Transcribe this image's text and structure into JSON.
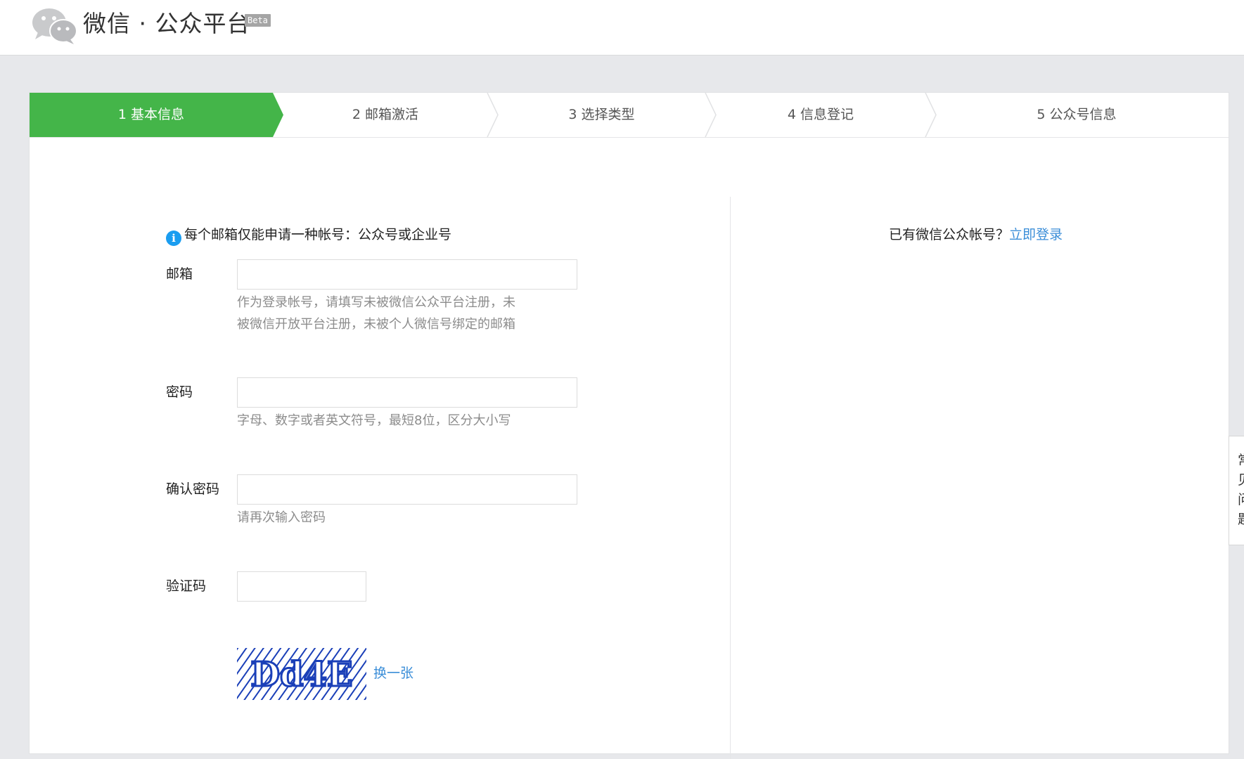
{
  "header": {
    "logo_text": "微信 · 公众平台",
    "beta": "Beta"
  },
  "steps": [
    {
      "label": "1 基本信息",
      "active": true
    },
    {
      "label": "2 邮箱激活",
      "active": false
    },
    {
      "label": "3 选择类型",
      "active": false
    },
    {
      "label": "4 信息登记",
      "active": false
    },
    {
      "label": "5 公众号信息",
      "active": false
    }
  ],
  "colors": {
    "active_step": "#44b549",
    "link": "#3b8ed8",
    "info_icon": "#1a9df0",
    "captcha": "#1a3fb8"
  },
  "notice": {
    "icon": "info-icon",
    "text": "每个邮箱仅能申请一种帐号：公众号或企业号"
  },
  "login": {
    "question": "已有微信公众帐号？",
    "link": "立即登录"
  },
  "form": {
    "email": {
      "label": "邮箱",
      "value": "",
      "help_line1": "作为登录帐号，请填写未被微信公众平台注册，未",
      "help_line2": "被微信开放平台注册，未被个人微信号绑定的邮箱"
    },
    "password": {
      "label": "密码",
      "value": "",
      "help": "字母、数字或者英文符号，最短8位，区分大小写"
    },
    "confirm_password": {
      "label": "确认密码",
      "value": "",
      "help": "请再次输入密码"
    },
    "captcha": {
      "label": "验证码",
      "value": "",
      "image_text": "Dd4E",
      "refresh": "换一张"
    }
  },
  "side_tab": {
    "chars": [
      "常",
      "见",
      "问",
      "题"
    ]
  }
}
